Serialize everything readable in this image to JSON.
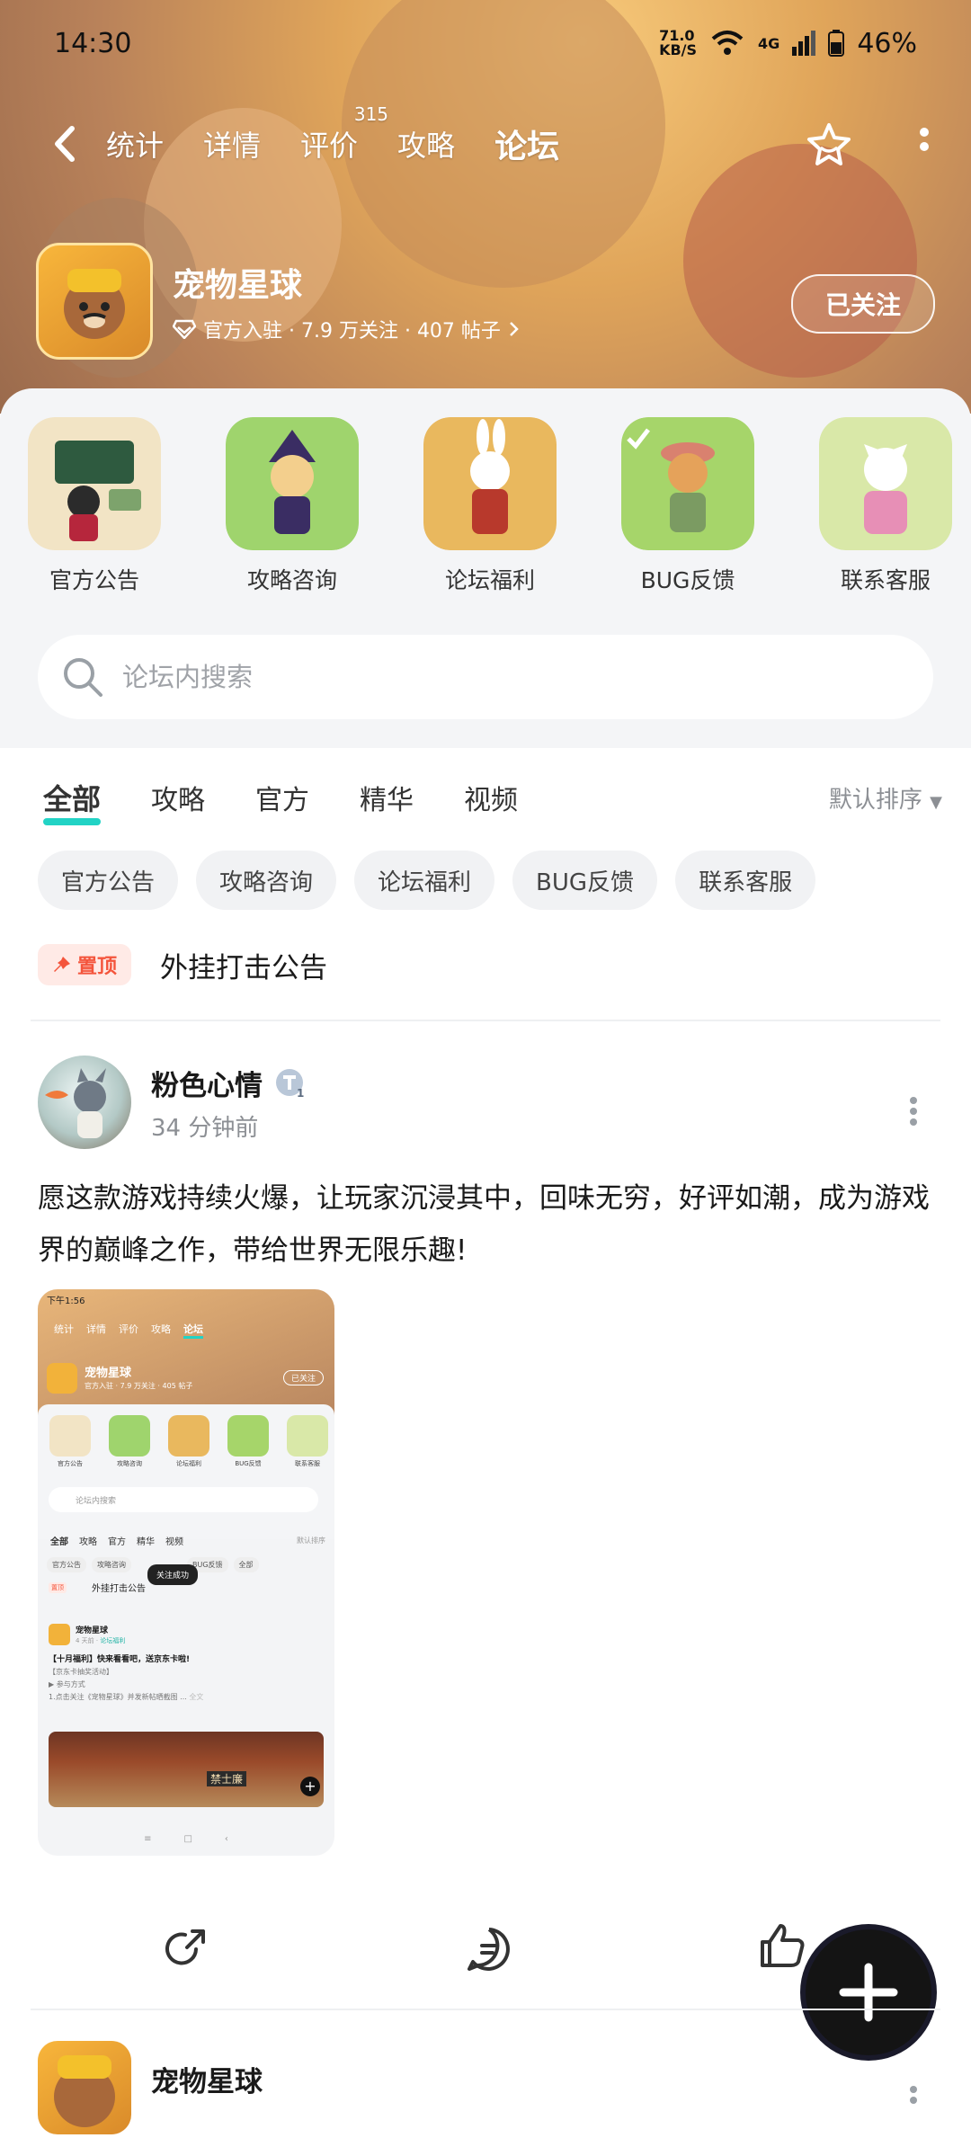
{
  "status_bar": {
    "time": "14:30",
    "net_speed": "71.0\nKB/S",
    "network": "4G",
    "battery": "46%"
  },
  "nav": {
    "tabs": [
      {
        "label": "统计"
      },
      {
        "label": "详情"
      },
      {
        "label": "评价",
        "badge": "315"
      },
      {
        "label": "攻略"
      },
      {
        "label": "论坛",
        "active": true
      }
    ]
  },
  "game": {
    "name": "宠物星球",
    "meta": "官方入驻 · 7.9 万关注 · 407 帖子",
    "follow_label": "已关注"
  },
  "categories": [
    {
      "label": "官方公告",
      "color": "#f2e4c5"
    },
    {
      "label": "攻略咨询",
      "color": "#9fd46d"
    },
    {
      "label": "论坛福利",
      "color": "#e9b85e"
    },
    {
      "label": "BUG反馈",
      "color": "#a6d56a"
    },
    {
      "label": "联系客服",
      "color": "#d9e8a8"
    }
  ],
  "search": {
    "placeholder": "论坛内搜索"
  },
  "filter": {
    "tabs": [
      "全部",
      "攻略",
      "官方",
      "精华",
      "视频"
    ],
    "sort": "默认排序"
  },
  "chips": [
    "官方公告",
    "攻略咨询",
    "论坛福利",
    "BUG反馈",
    "联系客服"
  ],
  "pinned": {
    "badge": "置顶",
    "title": "外挂打击公告"
  },
  "post": {
    "author": "粉色心情",
    "time": "34 分钟前",
    "body": "愿这款游戏持续火爆，让玩家沉浸其中，回味无穷，好评如潮，成为游戏界的巅峰之作，带给世界无限乐趣!"
  },
  "screenshot": {
    "time": "下午1:56",
    "tabs": [
      "统计",
      "详情",
      "评价",
      "攻略",
      "论坛"
    ],
    "game_name": "宠物星球",
    "meta": "官方入驻 · 7.9 万关注 · 405 帖子",
    "follow": "已关注",
    "cats": [
      "官方公告",
      "攻略咨询",
      "论坛福利",
      "BUG反馈",
      "联系客服"
    ],
    "search": "论坛内搜索",
    "filter": [
      "全部",
      "攻略",
      "官方",
      "精华",
      "视频"
    ],
    "sort": "默认排序",
    "chips": [
      "官方公告",
      "攻略咨询",
      "BUG反馈",
      "全部"
    ],
    "toast": "关注成功",
    "pin_badge": "置顶",
    "pin_title": "外挂打击公告",
    "post_name": "宠物星球",
    "post_time": "4 天前 · ",
    "post_tag": "论坛福利",
    "post_title": "【十月福利】快来看看吧，送京东卡啦!",
    "post_line1": "【京东卡抽奖活动】",
    "post_line2": "▶ 参与方式",
    "post_line3": "1.点击关注《宠物星球》并发新帖晒截图 ...",
    "post_more": "全文",
    "sign": "禁士廉"
  },
  "post2": {
    "name": "宠物星球"
  }
}
